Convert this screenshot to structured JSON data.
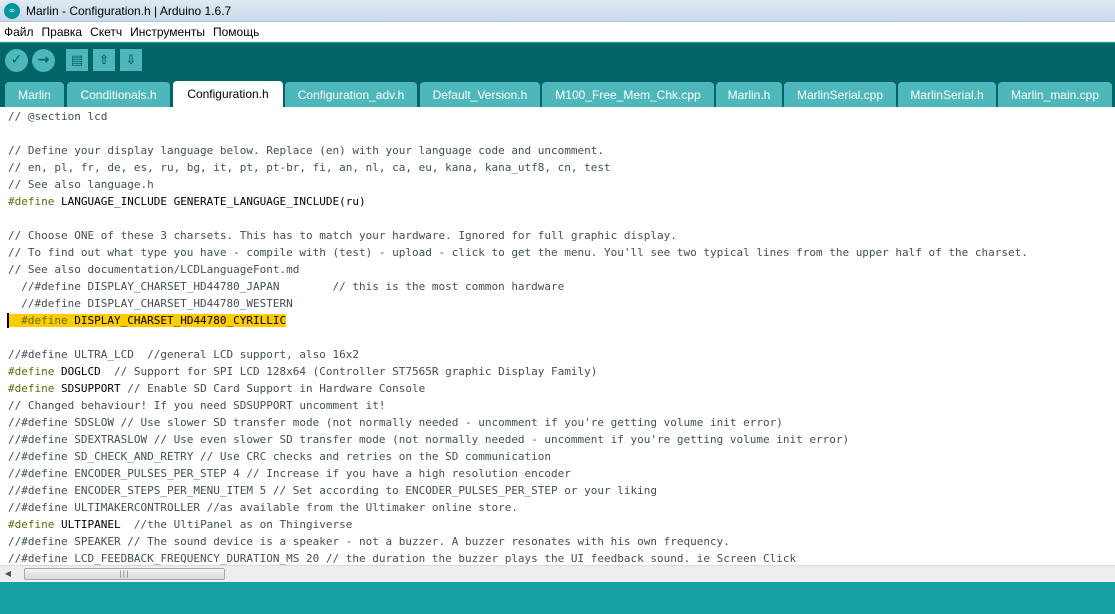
{
  "window": {
    "title": "Marlin - Configuration.h | Arduino 1.6.7",
    "icon_glyph": "∞"
  },
  "menu": [
    "Файл",
    "Правка",
    "Скетч",
    "Инструменты",
    "Помощь"
  ],
  "toolbar": {
    "verify_glyph": "✓",
    "upload_glyph": "→",
    "new_glyph": "▤",
    "open_glyph": "⇧",
    "save_glyph": "⇩"
  },
  "tabs": [
    {
      "label": "Marlin",
      "active": false
    },
    {
      "label": "Conditionals.h",
      "active": false
    },
    {
      "label": "Configuration.h",
      "active": true
    },
    {
      "label": "Configuration_adv.h",
      "active": false
    },
    {
      "label": "Default_Version.h",
      "active": false
    },
    {
      "label": "M100_Free_Mem_Chk.cpp",
      "active": false
    },
    {
      "label": "Marlin.h",
      "active": false
    },
    {
      "label": "MarlinSerial.cpp",
      "active": false
    },
    {
      "label": "MarlinSerial.h",
      "active": false
    },
    {
      "label": "Marlin_main.cpp",
      "active": false
    }
  ],
  "code": [
    {
      "text": "// @section lcd"
    },
    {
      "text": ""
    },
    {
      "text": "// Define your display language below. Replace (en) with your language code and uncomment."
    },
    {
      "text": "// en, pl, fr, de, es, ru, bg, it, pt, pt-br, fi, an, nl, ca, eu, kana, kana_utf8, cn, test"
    },
    {
      "text": "// See also language.h"
    },
    {
      "kw": "#define",
      "rest": " LANGUAGE_INCLUDE GENERATE_LANGUAGE_INCLUDE(ru)"
    },
    {
      "text": ""
    },
    {
      "text": "// Choose ONE of these 3 charsets. This has to match your hardware. Ignored for full graphic display."
    },
    {
      "text": "// To find out what type you have - compile with (test) - upload - click to get the menu. You'll see two typical lines from the upper half of the charset."
    },
    {
      "text": "// See also documentation/LCDLanguageFont.md"
    },
    {
      "text": "  //#define DISPLAY_CHARSET_HD44780_JAPAN        // this is the most common hardware"
    },
    {
      "text": "  //#define DISPLAY_CHARSET_HD44780_WESTERN"
    },
    {
      "kw": "  #define",
      "rest": " DISPLAY_CHARSET_HD44780_CYRILLIC",
      "highlight": true
    },
    {
      "text": ""
    },
    {
      "text": "//#define ULTRA_LCD  //general LCD support, also 16x2"
    },
    {
      "kw": "#define",
      "rest": " DOGLCD",
      "comment": "  // Support for SPI LCD 128x64 (Controller ST7565R graphic Display Family)"
    },
    {
      "kw": "#define",
      "rest": " SDSUPPORT",
      "comment": " // Enable SD Card Support in Hardware Console"
    },
    {
      "text": "// Changed behaviour! If you need SDSUPPORT uncomment it!"
    },
    {
      "text": "//#define SDSLOW // Use slower SD transfer mode (not normally needed - uncomment if you're getting volume init error)"
    },
    {
      "text": "//#define SDEXTRASLOW // Use even slower SD transfer mode (not normally needed - uncomment if you're getting volume init error)"
    },
    {
      "text": "//#define SD_CHECK_AND_RETRY // Use CRC checks and retries on the SD communication"
    },
    {
      "text": "//#define ENCODER_PULSES_PER_STEP 4 // Increase if you have a high resolution encoder"
    },
    {
      "text": "//#define ENCODER_STEPS_PER_MENU_ITEM 5 // Set according to ENCODER_PULSES_PER_STEP or your liking"
    },
    {
      "text": "//#define ULTIMAKERCONTROLLER //as available from the Ultimaker online store."
    },
    {
      "kw": "#define",
      "rest": " ULTIPANEL",
      "comment": "  //the UltiPanel as on Thingiverse"
    },
    {
      "text": "//#define SPEAKER // The sound device is a speaker - not a buzzer. A buzzer resonates with his own frequency."
    },
    {
      "text": "//#define LCD_FEEDBACK_FREQUENCY_DURATION_MS 20 // the duration the buzzer plays the UI feedback sound. ie Screen Click"
    }
  ],
  "scrollbar": {
    "left_glyph": "◀",
    "thumb_grip": "|||"
  }
}
